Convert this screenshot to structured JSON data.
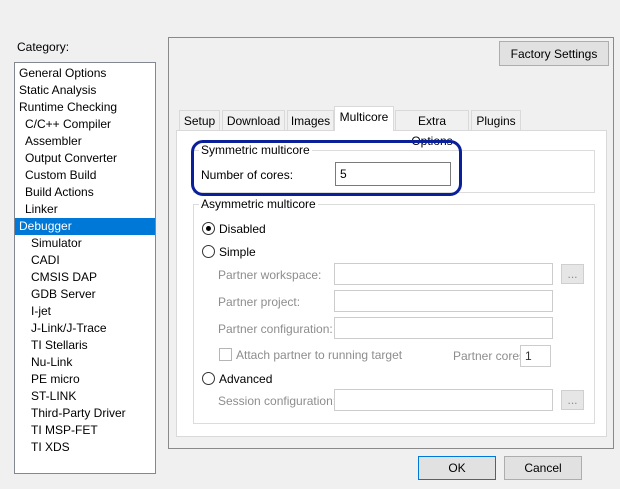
{
  "category": {
    "label": "Category:",
    "items": [
      {
        "label": "General Options",
        "indent": 0,
        "selected": false
      },
      {
        "label": "Static Analysis",
        "indent": 0,
        "selected": false
      },
      {
        "label": "Runtime Checking",
        "indent": 0,
        "selected": false
      },
      {
        "label": "C/C++ Compiler",
        "indent": 1,
        "selected": false
      },
      {
        "label": "Assembler",
        "indent": 1,
        "selected": false
      },
      {
        "label": "Output Converter",
        "indent": 1,
        "selected": false
      },
      {
        "label": "Custom Build",
        "indent": 1,
        "selected": false
      },
      {
        "label": "Build Actions",
        "indent": 1,
        "selected": false
      },
      {
        "label": "Linker",
        "indent": 1,
        "selected": false
      },
      {
        "label": "Debugger",
        "indent": 0,
        "selected": true
      },
      {
        "label": "Simulator",
        "indent": 2,
        "selected": false
      },
      {
        "label": "CADI",
        "indent": 2,
        "selected": false
      },
      {
        "label": "CMSIS DAP",
        "indent": 2,
        "selected": false
      },
      {
        "label": "GDB Server",
        "indent": 2,
        "selected": false
      },
      {
        "label": "I-jet",
        "indent": 2,
        "selected": false
      },
      {
        "label": "J-Link/J-Trace",
        "indent": 2,
        "selected": false
      },
      {
        "label": "TI Stellaris",
        "indent": 2,
        "selected": false
      },
      {
        "label": "Nu-Link",
        "indent": 2,
        "selected": false
      },
      {
        "label": "PE micro",
        "indent": 2,
        "selected": false
      },
      {
        "label": "ST-LINK",
        "indent": 2,
        "selected": false
      },
      {
        "label": "Third-Party Driver",
        "indent": 2,
        "selected": false
      },
      {
        "label": "TI MSP-FET",
        "indent": 2,
        "selected": false
      },
      {
        "label": "TI XDS",
        "indent": 2,
        "selected": false
      }
    ]
  },
  "factory_settings": "Factory Settings",
  "tabs": [
    {
      "label": "Setup",
      "active": false
    },
    {
      "label": "Download",
      "active": false
    },
    {
      "label": "Images",
      "active": false
    },
    {
      "label": "Multicore",
      "active": true
    },
    {
      "label": "Extra Options",
      "active": false
    },
    {
      "label": "Plugins",
      "active": false
    }
  ],
  "symmetric": {
    "title": "Symmetric multicore",
    "cores_label": "Number of cores:",
    "cores_value": "5"
  },
  "asymmetric": {
    "title": "Asymmetric multicore",
    "disabled_label": "Disabled",
    "simple_label": "Simple",
    "selected": "Disabled",
    "partner_workspace_label": "Partner workspace:",
    "partner_workspace_value": "",
    "browse_label": "...",
    "partner_project_label": "Partner project:",
    "partner_project_value": "",
    "partner_config_label": "Partner configuration:",
    "partner_config_value": "",
    "attach_label": "Attach partner to running target",
    "attach_checked": false,
    "partner_cores_label": "Partner cores",
    "partner_cores_value": "1",
    "advanced_label": "Advanced",
    "session_config_label": "Session configuration:",
    "session_config_value": ""
  },
  "buttons": {
    "ok": "OK",
    "cancel": "Cancel"
  },
  "colors": {
    "selection": "#0078d7",
    "highlight_outline": "#0a1f9a"
  }
}
